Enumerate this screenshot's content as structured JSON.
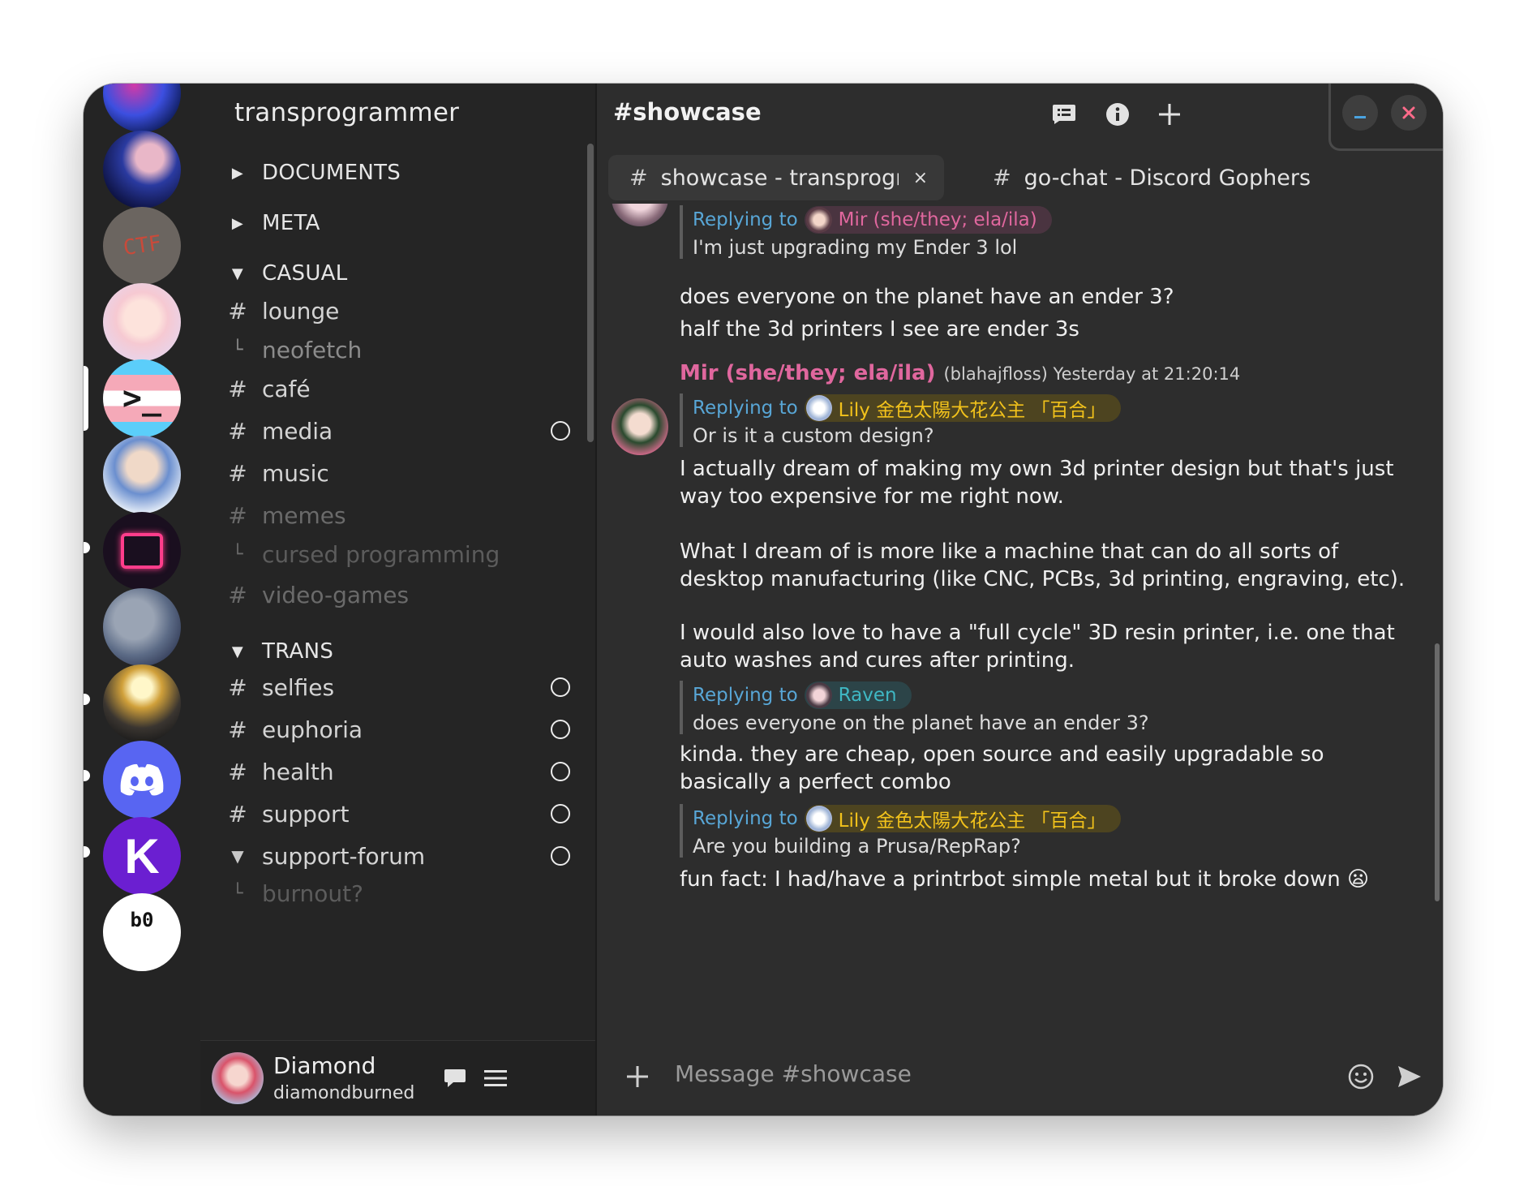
{
  "server": {
    "name": "transprogrammer"
  },
  "rail": {
    "bottom_server_label": "b0"
  },
  "categories": [
    {
      "label": "DOCUMENTS"
    },
    {
      "label": "META"
    },
    {
      "label": "CASUAL"
    },
    {
      "label": "TRANS"
    }
  ],
  "channels": {
    "lounge": "lounge",
    "neofetch": "neofetch",
    "cafe": "café",
    "media": "media",
    "music": "music",
    "memes": "memes",
    "cursed": "cursed programming",
    "videogames": "video-games",
    "selfies": "selfies",
    "euphoria": "euphoria",
    "health": "health",
    "support": "support",
    "supportforum": "support-forum",
    "burnout": "burnout?"
  },
  "user": {
    "display_name": "Diamond",
    "username": "diamondburned"
  },
  "header": {
    "title": "#showcase"
  },
  "tabs": [
    {
      "label": "showcase - transprogrammer",
      "close": "×"
    },
    {
      "label": "go-chat - Discord Gophers"
    }
  ],
  "messages": {
    "reply_label": "Replying to",
    "r1_name": "Mir (she/they; ela/ila)",
    "r1_text": "I'm just upgrading my Ender 3 lol",
    "l1": "does everyone on the planet have an ender 3?",
    "l2": "half the 3d printers I see are ender 3s",
    "author": "Mir (she/they; ela/ila)",
    "author_meta": "(blahajfloss) Yesterday at 21:20:14",
    "r2_name": "Lily 金色太陽大花公主 「百合」",
    "r2_text": "Or is it a custom design?",
    "l3": "I actually dream of making my own 3d printer design but that's just",
    "l4": "way too expensive for me right now.",
    "l5": "What I dream of is more like a machine that can do all sorts of",
    "l6": "desktop manufacturing (like CNC, PCBs, 3d printing, engraving, etc).",
    "l7": "I would also love to have a \"full cycle\" 3D resin printer, i.e. one that",
    "l8": "auto washes and cures after printing.",
    "r3_name": "Raven",
    "r3_text": "does everyone on the planet have an ender 3?",
    "l9": "kinda. they are cheap, open source and easily upgradable so",
    "l10": "basically a perfect combo",
    "r4_name": "Lily 金色太陽大花公主 「百合」",
    "r4_text": "Are you building a Prusa/RepRap?",
    "l11": "fun fact: I had/have a printrbot simple metal but it broke down 😦"
  },
  "composer": {
    "placeholder": "Message #showcase"
  },
  "colors": {
    "mir": "#e0679e",
    "lily": "#f2c21b",
    "raven": "#3fb8c4",
    "reply_label": "#58a6d6",
    "minimize": "#4aa3e0",
    "close": "#ff6b8a"
  }
}
